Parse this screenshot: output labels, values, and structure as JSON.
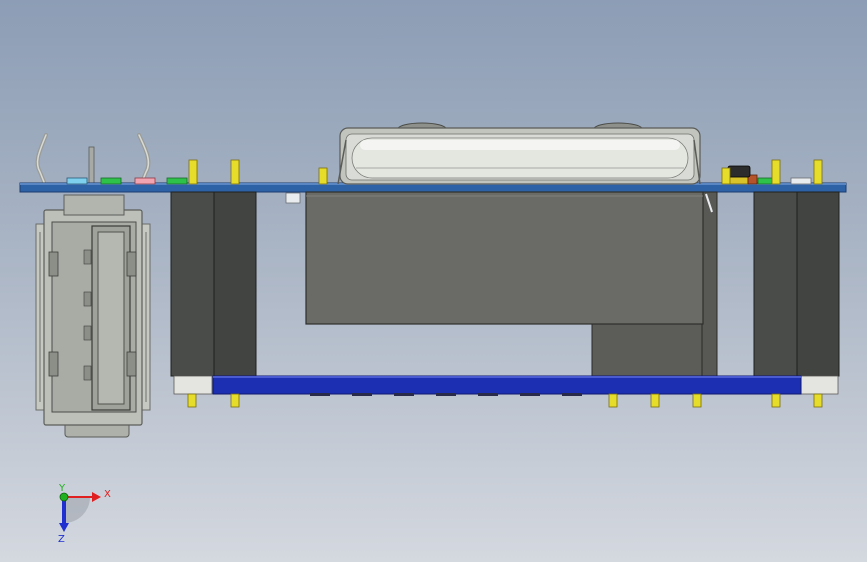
{
  "viewport": {
    "background_top": "#8c9db5",
    "background_bottom": "#d4d8df"
  },
  "colors": {
    "pcb_top": "#2e62a6",
    "pcb_bottom": "#1c2fb2",
    "pin": "#e6dc2a",
    "module": "#6a6b66",
    "header": "#4a4c4a",
    "usb_housing": "#b9bbb5",
    "battery": "#d9dcd6"
  },
  "triad": {
    "x_label": "X",
    "y_label": "Y",
    "z_label": "Z",
    "x_color": "#e02020",
    "y_color": "#20b020",
    "z_color": "#2030d0"
  }
}
